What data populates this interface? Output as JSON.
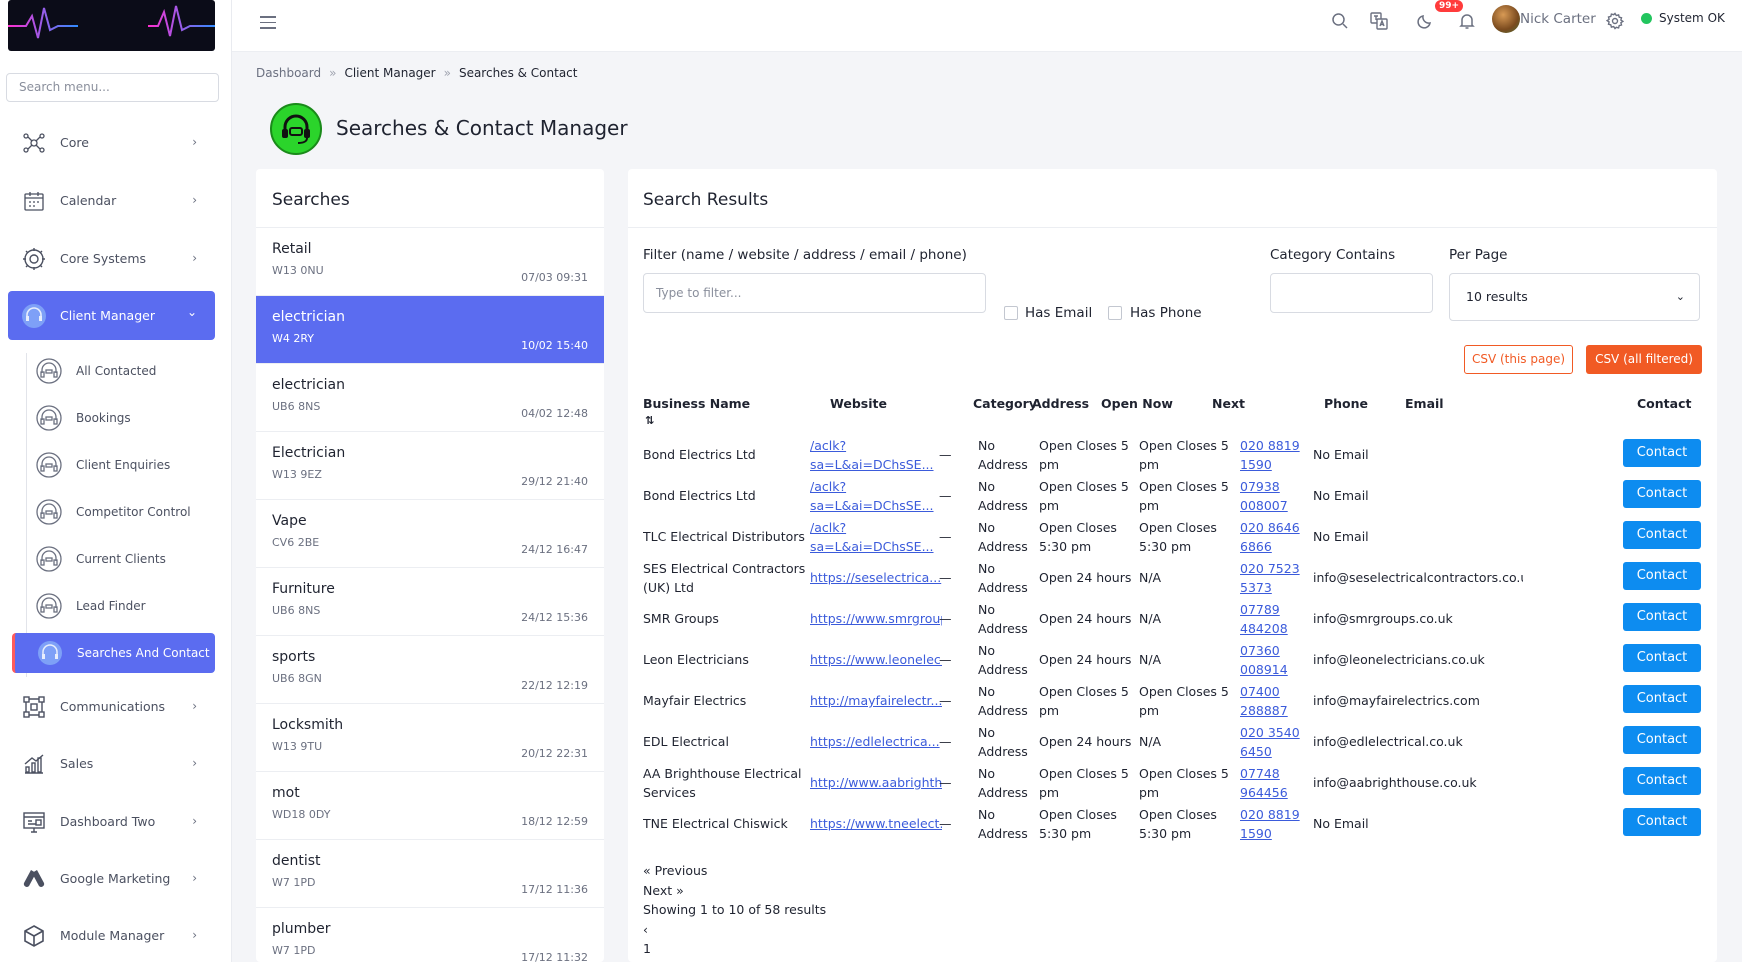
{
  "sidebar": {
    "search_placeholder": "Search menu...",
    "items": [
      {
        "label": "Core",
        "icon": "hub-icon"
      },
      {
        "label": "Calendar",
        "icon": "calendar-icon"
      },
      {
        "label": "Core Systems",
        "icon": "gear-icon"
      },
      {
        "label": "Client Manager",
        "icon": "headset-icon"
      },
      {
        "label": "Communications",
        "icon": "network-icon"
      },
      {
        "label": "Sales",
        "icon": "bar-chart-icon"
      },
      {
        "label": "Dashboard Two",
        "icon": "dashboard-icon"
      },
      {
        "label": "Google Marketing",
        "icon": "google-ads-icon"
      },
      {
        "label": "Module Manager",
        "icon": "cube-icon"
      }
    ],
    "sub_items": [
      {
        "label": "All Contacted"
      },
      {
        "label": "Bookings"
      },
      {
        "label": "Client Enquiries"
      },
      {
        "label": "Competitor Control"
      },
      {
        "label": "Current Clients"
      },
      {
        "label": "Lead Finder"
      },
      {
        "label": "Searches And Contact"
      }
    ]
  },
  "topbar": {
    "notification_badge": "99+",
    "user_name": "Nick Carter",
    "status": "System OK"
  },
  "breadcrumb": [
    "Dashboard",
    "Client Manager",
    "Searches & Contact"
  ],
  "breadcrumb_sep": "»",
  "page_title": "Searches & Contact Manager",
  "searches": {
    "title": "Searches",
    "items": [
      {
        "name": "Retail",
        "postcode": "W13 0NU",
        "date": "07/03 09:31"
      },
      {
        "name": "electrician",
        "postcode": "W4 2RY",
        "date": "10/02 15:40"
      },
      {
        "name": "electrician",
        "postcode": "UB6 8NS",
        "date": "04/02 12:48"
      },
      {
        "name": "Electrician",
        "postcode": "W13 9EZ",
        "date": "29/12 21:40"
      },
      {
        "name": "Vape",
        "postcode": "CV6 2BE",
        "date": "24/12 16:47"
      },
      {
        "name": "Furniture",
        "postcode": "UB6 8NS",
        "date": "24/12 15:36"
      },
      {
        "name": "sports",
        "postcode": "UB6 8GN",
        "date": "22/12 12:19"
      },
      {
        "name": "Locksmith",
        "postcode": "W13 9TU",
        "date": "20/12 22:31"
      },
      {
        "name": "mot",
        "postcode": "WD18 0DY",
        "date": "18/12 12:59"
      },
      {
        "name": "dentist",
        "postcode": "W7 1PD",
        "date": "17/12 11:36"
      },
      {
        "name": "plumber",
        "postcode": "W7 1PD",
        "date": "17/12 11:32"
      }
    ]
  },
  "results": {
    "title": "Search Results",
    "filter_label": "Filter (name / website / address / email / phone)",
    "filter_placeholder": "Type to filter...",
    "has_email": "Has Email",
    "has_phone": "Has Phone",
    "category_label": "Category Contains",
    "per_page_label": "Per Page",
    "per_page_value": "10 results",
    "csv_page": "CSV (this page)",
    "csv_all": "CSV (all filtered)",
    "columns": [
      "Business Name",
      "Website",
      "Category",
      "Address",
      "Open Now",
      "Next",
      "Phone",
      "Email",
      "Contact"
    ],
    "sort_glyph": "⇅",
    "rows": [
      {
        "name": "Bond Electrics Ltd",
        "website": "/aclk?sa=L&ai=DChsSE...",
        "category": "—",
        "address": "No Address",
        "open_now": "Open Closes 5 pm",
        "next": "Open Closes 5 pm",
        "phone": "020 8819 1590",
        "email": "No Email"
      },
      {
        "name": "Bond Electrics Ltd",
        "website": "/aclk?sa=L&ai=DChsSE...",
        "category": "—",
        "address": "No Address",
        "open_now": "Open Closes 5 pm",
        "next": "Open Closes 5 pm",
        "phone": "07938 008007",
        "email": "No Email"
      },
      {
        "name": "TLC Electrical Distributors",
        "website": "/aclk?sa=L&ai=DChsSE...",
        "category": "—",
        "address": "No Address",
        "open_now": "Open Closes 5:30 pm",
        "next": "Open Closes 5:30 pm",
        "phone": "020 8646 6866",
        "email": "No Email"
      },
      {
        "name": "SES Electrical Contractors (UK) Ltd",
        "website": "https://seselectrica...",
        "category": "—",
        "address": "No Address",
        "open_now": "Open 24 hours",
        "next": "N/A",
        "phone": "020 7523 5373",
        "email": "info@seselectricalcontractors.co.uk"
      },
      {
        "name": "SMR Groups",
        "website": "https://www.smrgroup...",
        "category": "—",
        "address": "No Address",
        "open_now": "Open 24 hours",
        "next": "N/A",
        "phone": "07789 484208",
        "email": "info@smrgroups.co.uk"
      },
      {
        "name": "Leon Electricians",
        "website": "https://www.leonelec...",
        "category": "—",
        "address": "No Address",
        "open_now": "Open 24 hours",
        "next": "N/A",
        "phone": "07360 008914",
        "email": "info@leonelectricians.co.uk"
      },
      {
        "name": "Mayfair Electrics",
        "website": "http://mayfairelectr...",
        "category": "—",
        "address": "No Address",
        "open_now": "Open Closes 5 pm",
        "next": "Open Closes 5 pm",
        "phone": "07400 288887",
        "email": "info@mayfairelectrics.com"
      },
      {
        "name": "EDL Electrical",
        "website": "https://edlelectrica...",
        "category": "—",
        "address": "No Address",
        "open_now": "Open 24 hours",
        "next": "N/A",
        "phone": "020 3540 6450",
        "email": "info@edlelectrical.co.uk"
      },
      {
        "name": "AA Brighthouse Electrical Services",
        "website": "http://www.aabrighth...",
        "category": "—",
        "address": "No Address",
        "open_now": "Open Closes 5 pm",
        "next": "Open Closes 5 pm",
        "phone": "07748 964456",
        "email": "info@aabrighthouse.co.uk"
      },
      {
        "name": "TNE Electrical Chiswick",
        "website": "https://www.tneelect...",
        "category": "—",
        "address": "No Address",
        "open_now": "Open Closes 5:30 pm",
        "next": "Open Closes 5:30 pm",
        "phone": "020 8819 1590",
        "email": "No Email"
      }
    ],
    "contact_label": "Contact",
    "pagination": {
      "previous": "« Previous",
      "next": "Next »",
      "summary": "Showing 1 to 10 of 58 results",
      "prev_symbol": "‹",
      "page": "1"
    }
  }
}
